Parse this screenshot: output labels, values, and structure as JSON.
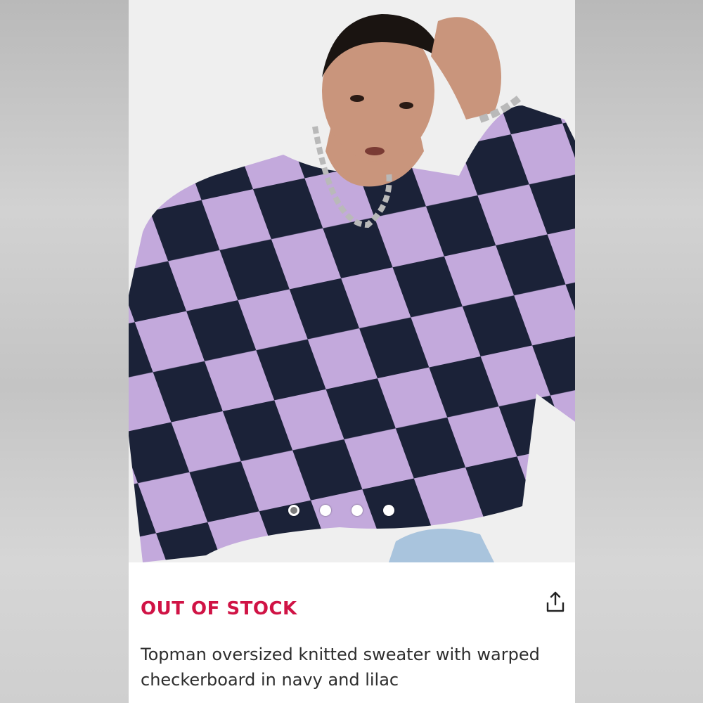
{
  "product": {
    "status": "OUT OF STOCK",
    "title": "Topman oversized knitted sweater with warped checkerboard in navy and lilac",
    "image_alt": "Model wearing navy and lilac warped checkerboard knitted sweater",
    "image_count": 4,
    "active_image_index": 0
  },
  "actions": {
    "share_icon": "share-icon"
  },
  "colors": {
    "status_red": "#d01345",
    "navy": "#1b2238",
    "lilac": "#c3a9dc",
    "text": "#2d2d2d"
  }
}
